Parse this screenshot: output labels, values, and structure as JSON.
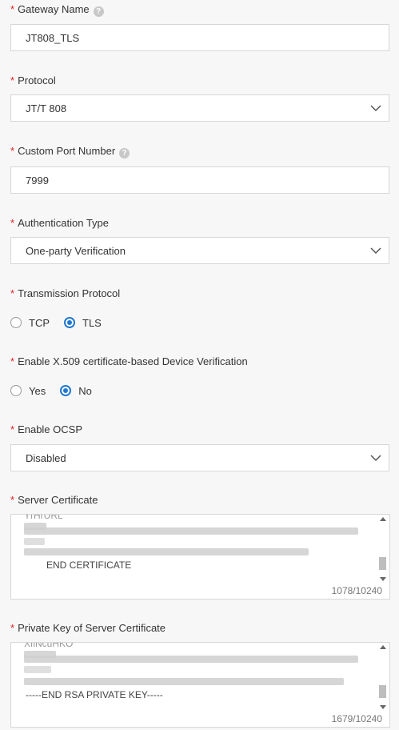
{
  "gateway_name": {
    "label": "Gateway Name",
    "value": "JT808_TLS",
    "required_mark": "*"
  },
  "protocol": {
    "label": "Protocol",
    "selected": "JT/T 808",
    "required_mark": "*"
  },
  "custom_port": {
    "label": "Custom Port Number",
    "value": "7999",
    "required_mark": "*"
  },
  "auth_type": {
    "label": "Authentication Type",
    "selected": "One-party Verification",
    "required_mark": "*"
  },
  "transmission": {
    "label": "Transmission Protocol",
    "required_mark": "*",
    "options": [
      {
        "label": "TCP",
        "checked": false
      },
      {
        "label": "TLS",
        "checked": true
      }
    ]
  },
  "x509": {
    "label": "Enable X.509 certificate-based Device Verification",
    "required_mark": "*",
    "options": [
      {
        "label": "Yes",
        "checked": false
      },
      {
        "label": "No",
        "checked": true
      }
    ]
  },
  "ocsp": {
    "label": "Enable OCSP",
    "selected": "Disabled",
    "required_mark": "*"
  },
  "server_cert": {
    "label": "Server Certificate",
    "required_mark": "*",
    "top_fragment": "YrHrURL",
    "last_line": "END CERTIFICATE",
    "counter": "1078/10240"
  },
  "private_key": {
    "label": "Private Key of Server Certificate",
    "required_mark": "*",
    "top_fragment": "XfiNcuHKO",
    "last_line": "-----END RSA PRIVATE KEY-----",
    "counter": "1679/10240"
  },
  "icons": {
    "help": "question-circle-icon",
    "dropdown": "chevron-down-icon"
  },
  "colors": {
    "accent": "#1f78d1",
    "required": "#e02020",
    "border": "#d7d7d7"
  }
}
